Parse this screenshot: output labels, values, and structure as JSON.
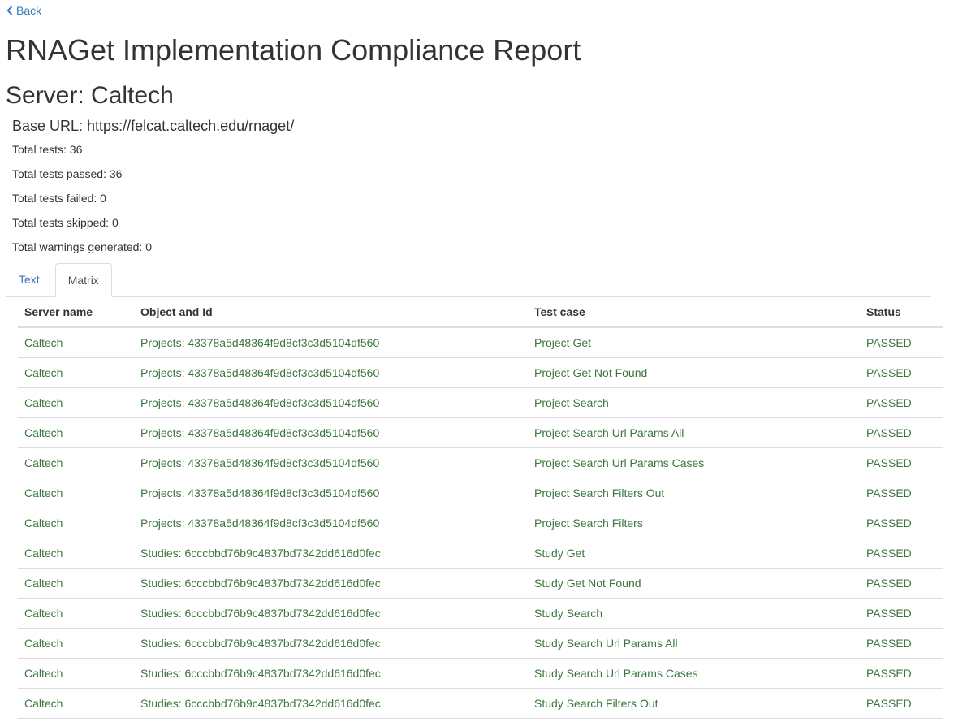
{
  "nav": {
    "back_label": "Back"
  },
  "header": {
    "title": "RNAGet Implementation Compliance Report",
    "server_title": "Server: Caltech",
    "base_url": "Base URL: https://felcat.caltech.edu/rnaget/"
  },
  "stats": [
    "Total tests: 36",
    "Total tests passed: 36",
    "Total tests failed: 0",
    "Total tests skipped: 0",
    "Total warnings generated: 0"
  ],
  "tabs": [
    {
      "label": "Text",
      "active": false
    },
    {
      "label": "Matrix",
      "active": true
    }
  ],
  "table": {
    "columns": [
      "Server name",
      "Object and Id",
      "Test case",
      "Status"
    ],
    "rows": [
      [
        "Caltech",
        "Projects: 43378a5d48364f9d8cf3c3d5104df560",
        "Project Get",
        "PASSED"
      ],
      [
        "Caltech",
        "Projects: 43378a5d48364f9d8cf3c3d5104df560",
        "Project Get Not Found",
        "PASSED"
      ],
      [
        "Caltech",
        "Projects: 43378a5d48364f9d8cf3c3d5104df560",
        "Project Search",
        "PASSED"
      ],
      [
        "Caltech",
        "Projects: 43378a5d48364f9d8cf3c3d5104df560",
        "Project Search Url Params All",
        "PASSED"
      ],
      [
        "Caltech",
        "Projects: 43378a5d48364f9d8cf3c3d5104df560",
        "Project Search Url Params Cases",
        "PASSED"
      ],
      [
        "Caltech",
        "Projects: 43378a5d48364f9d8cf3c3d5104df560",
        "Project Search Filters Out",
        "PASSED"
      ],
      [
        "Caltech",
        "Projects: 43378a5d48364f9d8cf3c3d5104df560",
        "Project Search Filters",
        "PASSED"
      ],
      [
        "Caltech",
        "Studies: 6cccbbd76b9c4837bd7342dd616d0fec",
        "Study Get",
        "PASSED"
      ],
      [
        "Caltech",
        "Studies: 6cccbbd76b9c4837bd7342dd616d0fec",
        "Study Get Not Found",
        "PASSED"
      ],
      [
        "Caltech",
        "Studies: 6cccbbd76b9c4837bd7342dd616d0fec",
        "Study Search",
        "PASSED"
      ],
      [
        "Caltech",
        "Studies: 6cccbbd76b9c4837bd7342dd616d0fec",
        "Study Search Url Params All",
        "PASSED"
      ],
      [
        "Caltech",
        "Studies: 6cccbbd76b9c4837bd7342dd616d0fec",
        "Study Search Url Params Cases",
        "PASSED"
      ],
      [
        "Caltech",
        "Studies: 6cccbbd76b9c4837bd7342dd616d0fec",
        "Study Search Filters Out",
        "PASSED"
      ]
    ]
  },
  "colors": {
    "link": "#337ab7",
    "passed": "#3c763d",
    "text": "#333333",
    "border": "#dddddd"
  },
  "icons": {
    "back": "chevron-left-icon"
  }
}
